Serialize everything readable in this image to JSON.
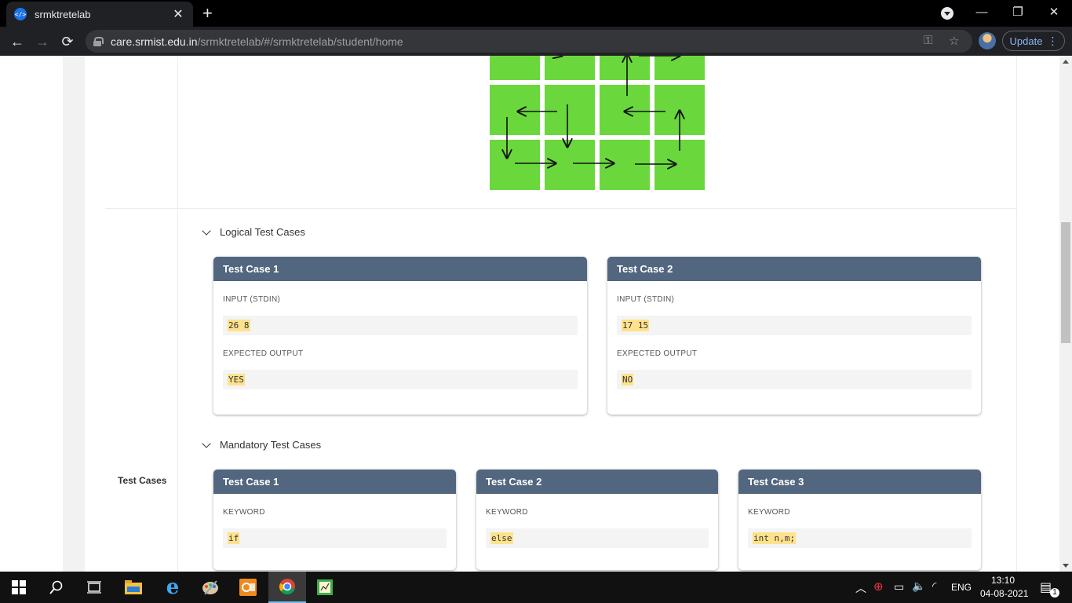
{
  "browser": {
    "tab_title": "srmktretelab",
    "url_host": "care.srmist.edu.in",
    "url_path": "/srmktretelab/#/srmktretelab/student/home",
    "update_label": "Update"
  },
  "page": {
    "logical": {
      "title": "Logical Test Cases",
      "cases": [
        {
          "title": "Test Case 1",
          "input_label": "INPUT (STDIN)",
          "input": "26 8",
          "output_label": "EXPECTED OUTPUT",
          "output": "YES"
        },
        {
          "title": "Test Case 2",
          "input_label": "INPUT (STDIN)",
          "input": "17 15",
          "output_label": "EXPECTED OUTPUT",
          "output": "NO"
        }
      ]
    },
    "mandatory": {
      "title": "Mandatory Test Cases",
      "cases": [
        {
          "title": "Test Case 1",
          "label": "KEYWORD",
          "value": "if"
        },
        {
          "title": "Test Case 2",
          "label": "KEYWORD",
          "value": "else"
        },
        {
          "title": "Test Case 3",
          "label": "KEYWORD",
          "value": "int n,m;"
        }
      ]
    },
    "row_label": "Test Cases"
  },
  "taskbar": {
    "language": "ENG",
    "time": "13:10",
    "date": "04-08-2021",
    "notification_count": "1"
  },
  "colors": {
    "card_header": "#52677f",
    "grid_green": "#6ad83c",
    "highlight": "#fde28b"
  }
}
